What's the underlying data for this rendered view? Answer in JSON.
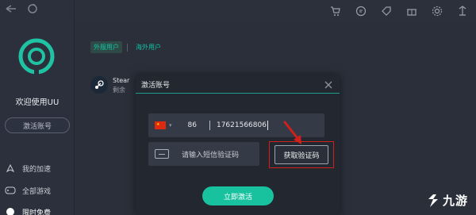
{
  "sidebar": {
    "welcome": "欢迎使用UU",
    "activate_label": "激活账号",
    "items": [
      {
        "label": "我的加速"
      },
      {
        "label": "全部游戏"
      },
      {
        "label": "限时免费"
      }
    ]
  },
  "main": {
    "tabs": [
      {
        "label": "外服用户"
      },
      {
        "label": "海外用户"
      }
    ],
    "game": {
      "name": "Stear",
      "subtitle": "剩余"
    }
  },
  "modal": {
    "title": "激活账号",
    "country_code": "86",
    "phone": "17621566806",
    "sms_placeholder": "请输入短信验证码",
    "get_code_label": "获取验证码",
    "submit_label": "立即激活"
  },
  "watermark": "九游",
  "colors": {
    "accent": "#19c29f",
    "highlight_red": "#d0201b"
  }
}
